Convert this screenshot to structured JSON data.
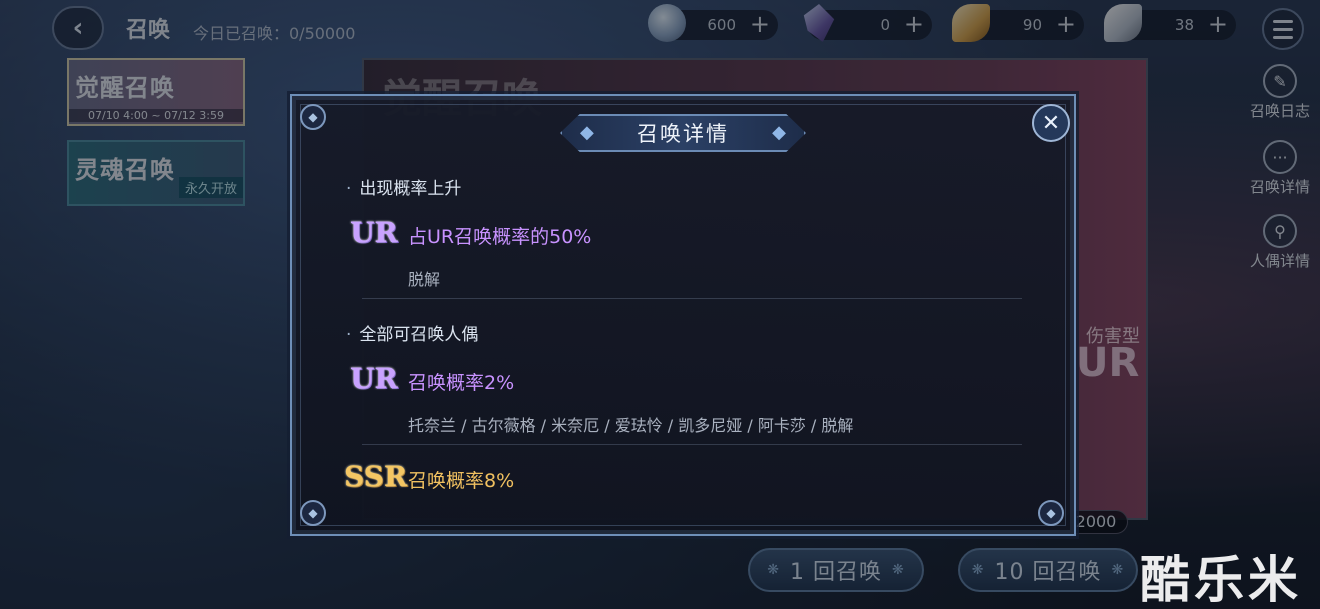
{
  "topbar": {
    "back_icon": "back-arrow-icon",
    "title": "召唤",
    "summon_count": "今日已召唤：0/50000",
    "resources": [
      {
        "icon": "crystal-egg-icon",
        "value": "600",
        "plus": "+"
      },
      {
        "icon": "prism-crystal-icon",
        "value": "0",
        "plus": "+"
      },
      {
        "icon": "golden-feather-icon",
        "value": "90",
        "plus": "+"
      },
      {
        "icon": "silver-feather-icon",
        "value": "38",
        "plus": "+"
      }
    ],
    "menu_icon": "hamburger-menu-icon"
  },
  "banners": [
    {
      "title": "觉醒召唤",
      "date": "07/10 4:00 ~ 07/12 3:59"
    },
    {
      "title": "灵魂召唤",
      "tag": "永久开放"
    }
  ],
  "side_menu": [
    {
      "icon": "note-icon",
      "label": "召唤日志"
    },
    {
      "icon": "ellipsis-icon",
      "label": "召唤详情"
    },
    {
      "icon": "doll-search-icon",
      "label": "人偶详情"
    }
  ],
  "background_card": {
    "title": "觉醒召唤",
    "type_label": "伤害型",
    "rarity": "UR",
    "cost": "2000"
  },
  "summon_buttons": {
    "single": "1 回召唤",
    "ten": "10 回召唤",
    "deco": "❋"
  },
  "watermark": "酷乐米",
  "modal": {
    "title": "召唤详情",
    "close_icon": "close-x-icon",
    "section_rateup": {
      "heading": "出现概率上升",
      "rarity": "UR",
      "rate_text": "占UR召唤概率的50%",
      "characters": "脱解"
    },
    "section_all": {
      "heading": "全部可召唤人偶",
      "ur": {
        "rarity": "UR",
        "rate_text": "召唤概率2%",
        "characters": "托奈兰 / 古尔薇格 / 米奈厄 / 爱珐怜 / 凯多尼娅 / 阿卡莎 / 脱解"
      },
      "ssr": {
        "rarity": "SSR",
        "rate_text": "召唤概率8%"
      }
    }
  },
  "colors": {
    "ur_purple": "#c892ff",
    "ssr_gold": "#f0c060",
    "modal_border": "#6e8fb8"
  }
}
